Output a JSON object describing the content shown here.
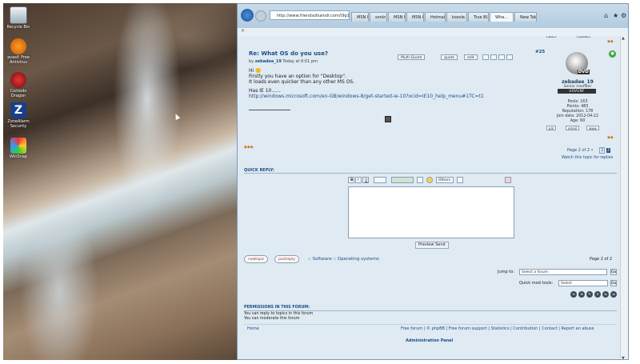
{
  "desktop": {
    "icons": [
      {
        "label": "Recycle Bin"
      },
      {
        "label": "avast! Free Antivirus"
      },
      {
        "label": "Comodo Dragon"
      },
      {
        "label": "ZoneAlarm Security"
      },
      {
        "label": "WinSnap"
      }
    ]
  },
  "browser": {
    "address": "http://www.friendsofsalvdr.com/t9p15",
    "tabs": [
      "MSN h...",
      "sonIn...",
      "MSN h...",
      "MSN h...",
      "Hotmai...",
      "kozole...",
      "True Bl...",
      "Wha...",
      "New Tab"
    ],
    "active_tab_index": 7
  },
  "post": {
    "title": "Re: What OS do you use?",
    "by": "by",
    "author": "zebadee_19",
    "time": "Today at 6:01 pm",
    "buttons": [
      "Multi-Quote",
      "quote",
      "edit"
    ],
    "line1": "Hi 🙂",
    "line2": "Firstly you have an option for \"Desktop\".",
    "line3": "It loads even quicker than any other MS OS.",
    "line4": "Has IE 10......",
    "link": "http://windows.microsoft.com/en-GB/windows-8/get-started-ie-10?ocid=IE10_help_menu#1TC=t1"
  },
  "profile": {
    "post_number": "#25",
    "avatar_badge": "DVD",
    "name": "zebadee_19",
    "rank": "Senior member",
    "rank_image": "UOVGNF",
    "posts": "Posts: 163",
    "points": "Points: 483",
    "reputation": "Reputation: 178",
    "join_date": "Join date: 2012-04-22",
    "age": "Age: 60",
    "email_btn": "email",
    "www_btn": "www",
    "pm_btn": "pm"
  },
  "pagination": {
    "text": "Page 2 of 2 •",
    "pages": [
      "1",
      "2"
    ],
    "watch": "Watch this topic for replies"
  },
  "quick_reply": {
    "label": "QUICK REPLY:",
    "toolbar": [
      "B",
      "I",
      "U",
      "Others"
    ],
    "preview": "Preview",
    "send": "Send"
  },
  "topic_footer": {
    "new_topic": "newtopic",
    "post_reply": "postreply",
    "crumbs": ":: Software :: Operating systems",
    "page": "Page 2 of 2",
    "jump_to": "Jump to:",
    "jump_select": "Select a forum",
    "go": "Go",
    "quick_mod": "Quick mod tools:",
    "quick_select": "Select"
  },
  "permissions": {
    "title": "PERMISSIONS IN THIS FORUM:",
    "line1": "You can reply to topics in this forum",
    "line2": "You can moderate this forum"
  },
  "footer": {
    "home": "Home",
    "links": "Free forum | © phpBB | Free forum support | Statistics | Contribution | Contact | Report an abuse",
    "admin": "Administration Panel"
  },
  "colors": {
    "accent": "#1e4d86",
    "page_bg": "#dfeaf2"
  }
}
